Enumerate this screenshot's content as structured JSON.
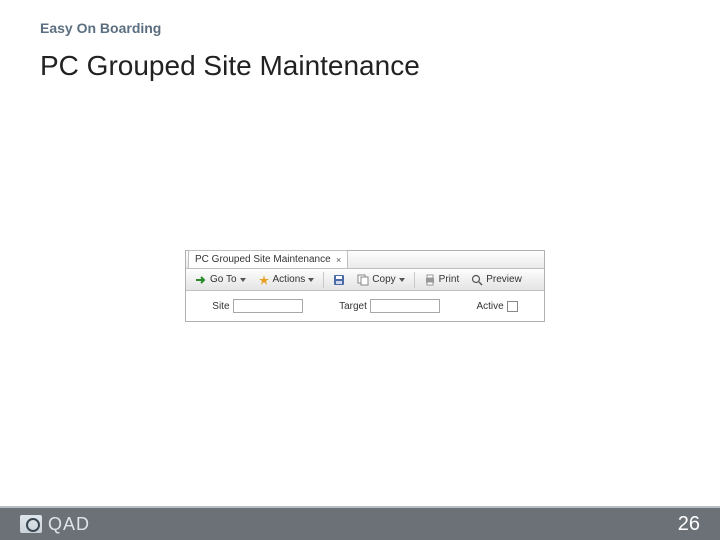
{
  "slide": {
    "pretitle": "Easy On Boarding",
    "title": "PC Grouped Site Maintenance",
    "page_number": "26",
    "brand": "QAD"
  },
  "window": {
    "tab_title": "PC Grouped Site Maintenance",
    "toolbar": {
      "goto": "Go To",
      "actions": "Actions",
      "copy": "Copy",
      "print": "Print",
      "preview": "Preview"
    },
    "form": {
      "label_site": "Site",
      "value_site": "",
      "label_target": "Target",
      "value_target": "",
      "label_active": "Active",
      "active_checked": false
    }
  },
  "icons": {
    "close": "×",
    "goto_arrow": "➔",
    "down": "▾",
    "actions_star": "✦",
    "disk": "💾",
    "copy": "⧉",
    "printer": "🖨",
    "preview": "🔍"
  }
}
